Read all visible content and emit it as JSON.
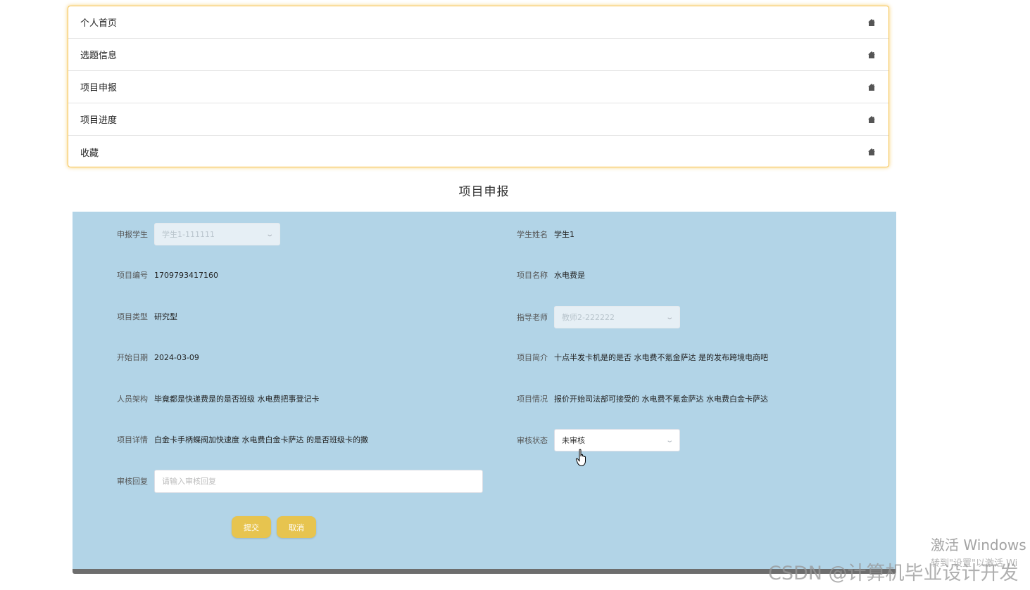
{
  "menu": {
    "items": [
      {
        "label": "个人首页",
        "icon": "home-icon"
      },
      {
        "label": "选题信息",
        "icon": "home-icon"
      },
      {
        "label": "项目申报",
        "icon": "home-icon"
      },
      {
        "label": "项目进度",
        "icon": "home-icon"
      },
      {
        "label": "收藏",
        "icon": "home-icon"
      }
    ]
  },
  "page": {
    "title": "项目申报"
  },
  "form": {
    "student": {
      "label": "申报学生",
      "value": "学生1-111111",
      "disabled": true
    },
    "student_name": {
      "label": "学生姓名",
      "value": "学生1"
    },
    "project_no": {
      "label": "项目编号",
      "value": "1709793417160"
    },
    "project_name": {
      "label": "项目名称",
      "value": "水电费是"
    },
    "project_type": {
      "label": "项目类型",
      "value": "研究型"
    },
    "teacher": {
      "label": "指导老师",
      "value": "教师2-222222",
      "disabled": true
    },
    "start_date": {
      "label": "开始日期",
      "value": "2024-03-09"
    },
    "intro": {
      "label": "项目简介",
      "value": "十点半发卡机是的是否 水电费不氪金萨达 是的发布跨境电商吧"
    },
    "team": {
      "label": "人员架构",
      "value": "毕竟都是快递费是的是否班级 水电费把事登记卡"
    },
    "situation": {
      "label": "项目情况",
      "value": "报价开始司法部可接受的 水电费不氪金萨达 水电费白金卡萨达"
    },
    "details": {
      "label": "项目详情",
      "value": "白金卡手柄蝶阀加快速度 水电费白金卡萨达 的是否班级卡的撒"
    },
    "review_status": {
      "label": "审核状态",
      "value": "未审核"
    },
    "review_reply": {
      "label": "审核回复",
      "placeholder": "请输入审核回复",
      "value": ""
    }
  },
  "buttons": {
    "submit": "提交",
    "cancel": "取消"
  },
  "watermarks": {
    "windows_line1": "激活 Windows",
    "windows_line2": "转到\"设置\"以激活 Wi",
    "csdn": "CSDN @计算机毕业设计开发"
  },
  "colors": {
    "panel_bg": "#b2d4e7",
    "button_bg": "#e7c44f",
    "menu_border": "#f6c65a"
  }
}
